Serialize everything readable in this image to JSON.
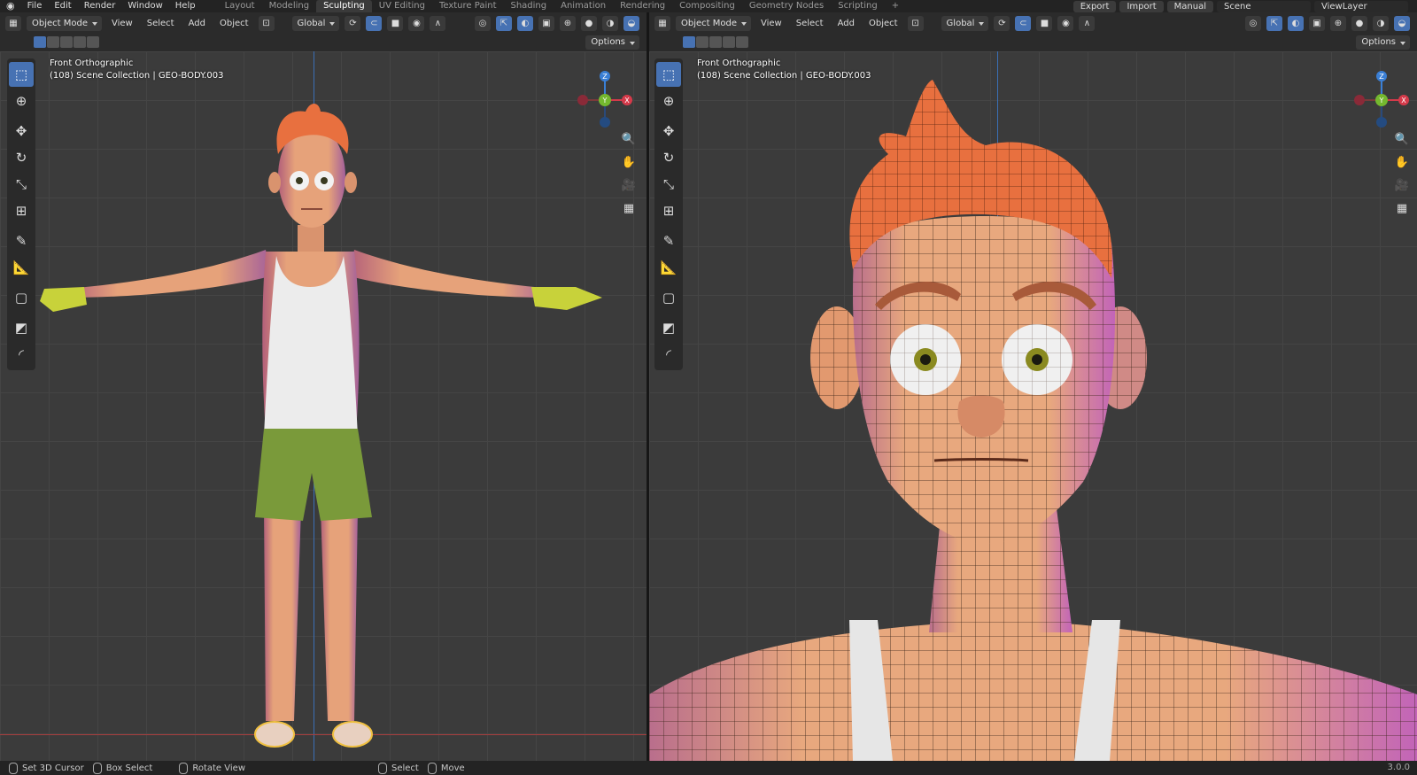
{
  "topbar": {
    "menus": [
      "File",
      "Edit",
      "Render",
      "Window",
      "Help"
    ],
    "workspaces": [
      "Layout",
      "Modeling",
      "Sculpting",
      "UV Editing",
      "Texture Paint",
      "Shading",
      "Animation",
      "Rendering",
      "Compositing",
      "Geometry Nodes",
      "Scripting"
    ],
    "active_workspace": "Sculpting",
    "export_label": "Export",
    "import_label": "Import",
    "manual_label": "Manual",
    "scene_value": "Scene",
    "viewlayer_value": "ViewLayer"
  },
  "viewport_header": {
    "mode": "Object Mode",
    "menus": [
      "View",
      "Select",
      "Add",
      "Object"
    ],
    "orientation": "Global",
    "options_label": "Options"
  },
  "left_viewport": {
    "view_name": "Front Orthographic",
    "collection_info": "(108) Scene Collection | GEO-BODY.003"
  },
  "right_viewport": {
    "view_name": "Front Orthographic",
    "collection_info": "(108) Scene Collection | GEO-BODY.003"
  },
  "gizmo": {
    "z_label": "Z",
    "y_label": "Y",
    "x_label": "X",
    "colors": {
      "x": "#d53a4a",
      "y": "#74b82f",
      "z": "#3a7fd5"
    }
  },
  "tools": [
    "select-box-icon",
    "cursor-icon",
    "move-icon",
    "rotate-icon",
    "scale-icon",
    "transform-icon",
    "annotate-icon",
    "measure-icon",
    "add-cube-icon",
    "extrude-icon",
    "bevel-icon"
  ],
  "statusbar": {
    "items": [
      "Set 3D Cursor",
      "Box Select",
      "Rotate View",
      "Select",
      "Move"
    ],
    "version": "3.0.0"
  },
  "colors": {
    "accent": "#4772b3",
    "skin": "#e6a27a",
    "hair": "#e8703f",
    "shirt": "#ececec",
    "shorts": "#7a9a3a",
    "glove": "#c8d23a"
  }
}
